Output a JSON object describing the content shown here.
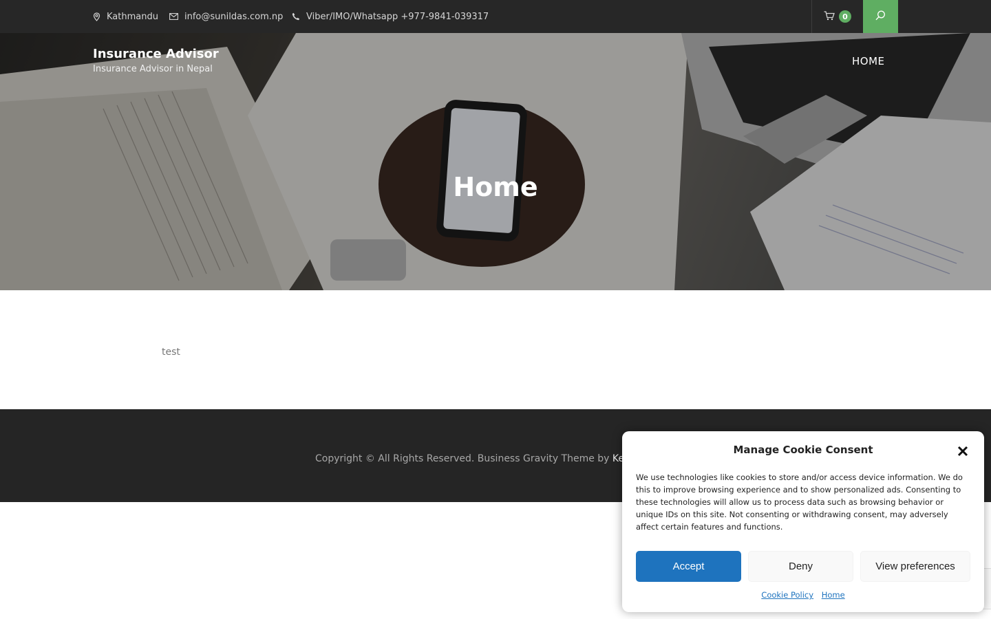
{
  "topbar": {
    "location": "Kathmandu",
    "email": "info@sunildas.com.np",
    "phone": "Viber/IMO/Whatsapp +977-9841-039317",
    "cart_count": "0",
    "icons": [
      "map-pin-icon",
      "envelope-icon",
      "phone-icon",
      "cart-icon",
      "search-icon"
    ]
  },
  "header": {
    "site_title": "Insurance Advisor",
    "tagline": "Insurance Advisor in Nepal",
    "nav": [
      {
        "label": "HOME"
      }
    ]
  },
  "hero": {
    "heading": "Home"
  },
  "main": {
    "content": "test"
  },
  "footer": {
    "copyright": "Copyright © All Rights Reserved. Business Gravity Theme by",
    "theme_author_visible": "Ke"
  },
  "cookie_consent": {
    "title": "Manage Cookie Consent",
    "body": "We use technologies like cookies to store and/or access device information. We do this to improve browsing experience and to show personalized ads. Consenting to these technologies will allow us to process data such as browsing behavior or unique IDs on this site. Not consenting or withdrawing consent, may adversely affect certain features and functions.",
    "accept_label": "Accept",
    "deny_label": "Deny",
    "preferences_label": "View preferences",
    "links": [
      {
        "label": "Cookie Policy"
      },
      {
        "label": "Home"
      }
    ]
  },
  "colors": {
    "topbar_bg": "#272727",
    "accent_green": "#5fae62",
    "footer_bg": "#252525",
    "accept_blue": "#1e73be"
  }
}
